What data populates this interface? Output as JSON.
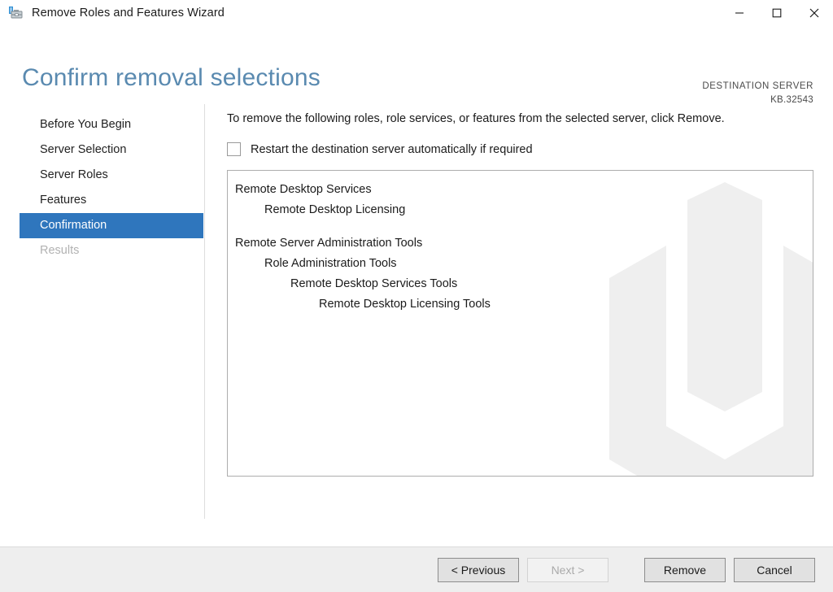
{
  "window": {
    "title": "Remove Roles and Features Wizard",
    "icon": "server-manager-toolbox-icon",
    "controls": {
      "minimize": "minimize-icon",
      "maximize": "maximize-icon",
      "close": "close-icon"
    }
  },
  "header": {
    "page_title": "Confirm removal selections",
    "destination_label": "DESTINATION SERVER",
    "destination_value": "KB.32543"
  },
  "sidebar": {
    "items": [
      {
        "label": "Before You Begin",
        "state": "normal"
      },
      {
        "label": "Server Selection",
        "state": "normal"
      },
      {
        "label": "Server Roles",
        "state": "normal"
      },
      {
        "label": "Features",
        "state": "normal"
      },
      {
        "label": "Confirmation",
        "state": "selected"
      },
      {
        "label": "Results",
        "state": "disabled"
      }
    ]
  },
  "main": {
    "instruction": "To remove the following roles, role services, or features from the selected server, click Remove.",
    "restart_checkbox": {
      "label": "Restart the destination server automatically if required",
      "checked": false
    },
    "removal_list": [
      {
        "text": "Remote Desktop Services",
        "level": 0,
        "spacer_before": false
      },
      {
        "text": "Remote Desktop Licensing",
        "level": 1,
        "spacer_before": false
      },
      {
        "text": "Remote Server Administration Tools",
        "level": 0,
        "spacer_before": true
      },
      {
        "text": "Role Administration Tools",
        "level": 1,
        "spacer_before": false
      },
      {
        "text": "Remote Desktop Services Tools",
        "level": 2,
        "spacer_before": false
      },
      {
        "text": "Remote Desktop Licensing Tools",
        "level": 3,
        "spacer_before": false
      }
    ]
  },
  "footer": {
    "previous": "< Previous",
    "next": "Next >",
    "remove": "Remove",
    "cancel": "Cancel",
    "next_disabled": true
  },
  "colors": {
    "accent_blue": "#2f76bd",
    "title_blue": "#5a8ab0",
    "footer_bg": "#eeeeee",
    "listbox_border": "#adadad",
    "watermark": "#efefef"
  }
}
